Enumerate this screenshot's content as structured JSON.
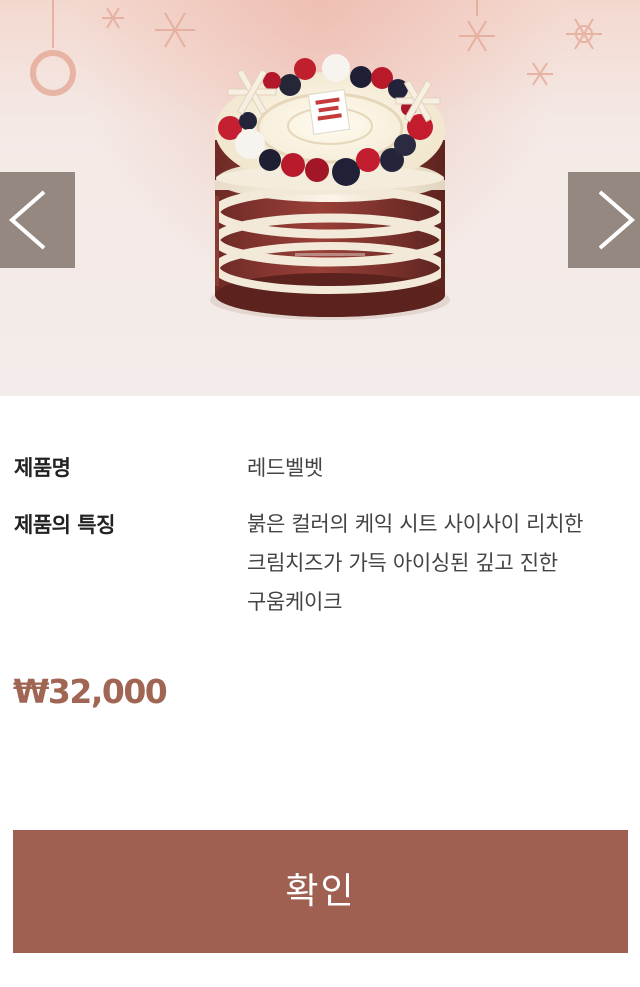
{
  "product": {
    "image_alt": "레드벨벳 케이크",
    "nav": {
      "prev_icon": "chevron-left-icon",
      "next_icon": "chevron-right-icon"
    },
    "name_label": "제품명",
    "name_value": "레드벨벳",
    "feature_label": "제품의 특징",
    "feature_value": "붉은 컬러의 케익 시트 사이사이 리치한 크림치즈가 가득 아이싱된 깊고 진한 구움케이크",
    "price": "₩32,000"
  },
  "actions": {
    "confirm_label": "확인"
  },
  "colors": {
    "accent": "#a06051",
    "price": "#a06553",
    "nav_overlay": "#7a6c64"
  }
}
